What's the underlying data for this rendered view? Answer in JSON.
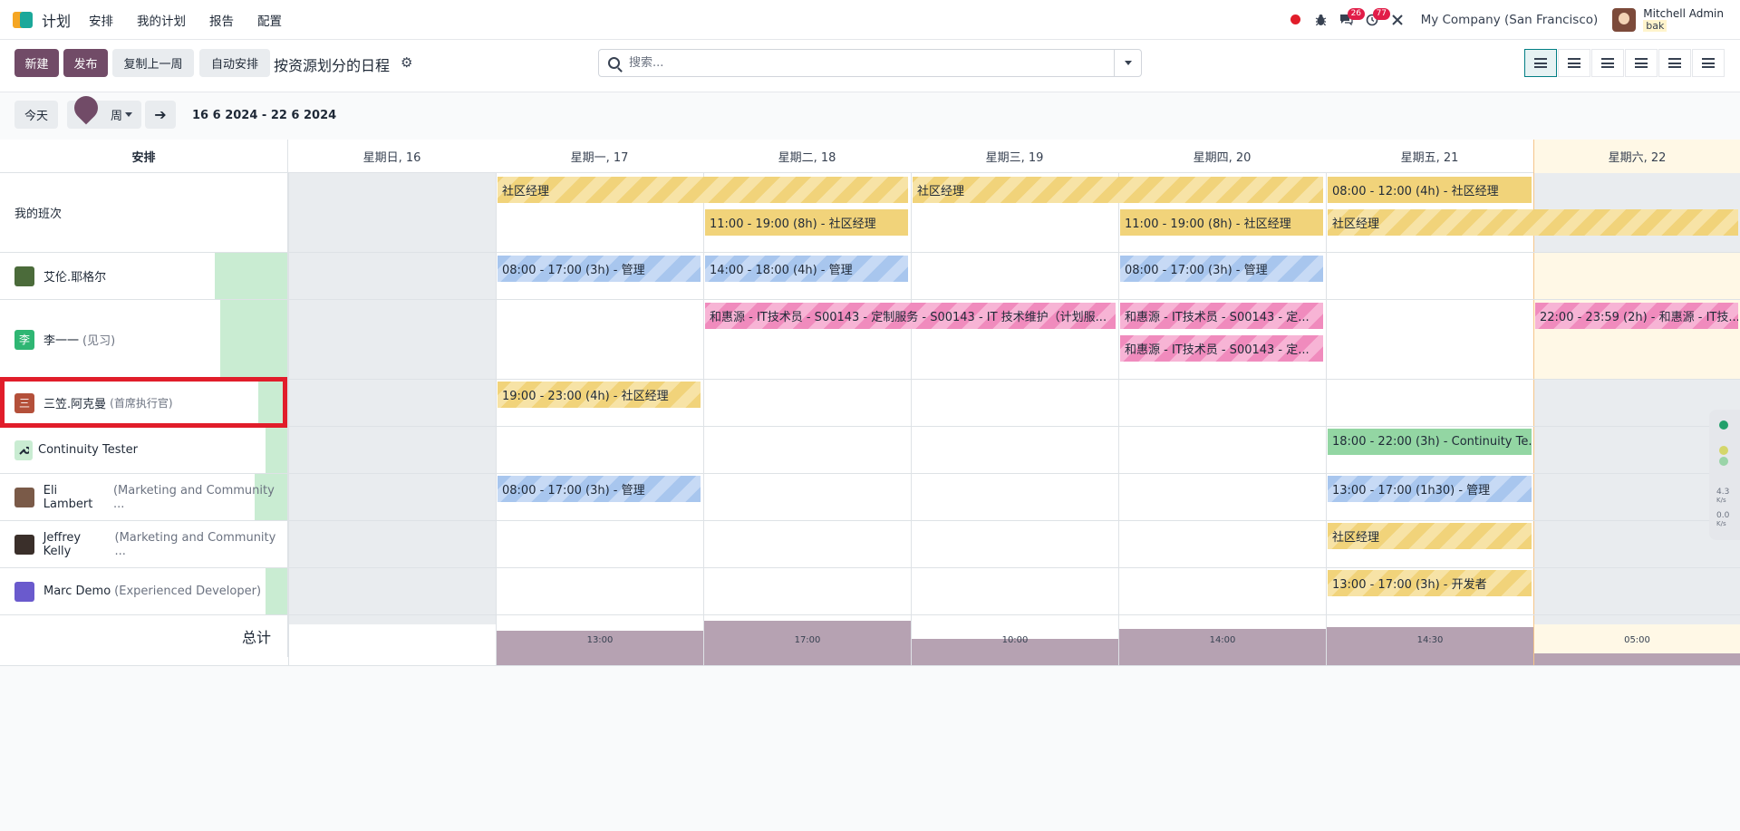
{
  "navbar": {
    "app_name": "计划",
    "menu": [
      "安排",
      "我的计划",
      "报告",
      "配置"
    ],
    "chat_badge": "26",
    "activity_badge": "77",
    "company": "My Company (San Francisco)",
    "user_name": "Mitchell Admin",
    "user_db": "bak"
  },
  "control": {
    "new_label": "新建",
    "publish_label": "发布",
    "copy_prev_label": "复制上一周",
    "auto_plan_label": "自动安排",
    "view_title": "按资源划分的日程",
    "search_placeholder": "搜索..."
  },
  "toolbar": {
    "today_label": "今天",
    "scale_label": "周",
    "range_label": "16 6 2024 - 22 6 2024"
  },
  "gantt": {
    "header_first": "安排",
    "days": [
      "星期日, 16",
      "星期一, 17",
      "星期二, 18",
      "星期三, 19",
      "星期四, 20",
      "星期五, 21",
      "星期六, 22"
    ],
    "rows": [
      {
        "name": "我的班次",
        "sub": ""
      },
      {
        "name": "艾伦.耶格尔",
        "sub": ""
      },
      {
        "name": "李一一",
        "sub": "(见习)",
        "initial": "李"
      },
      {
        "name": "三笠.阿克曼",
        "sub": "(首席执行官)",
        "initial": "三"
      },
      {
        "name": "Continuity Tester",
        "sub": ""
      },
      {
        "name": "Eli Lambert",
        "sub": "(Marketing and Community ..."
      },
      {
        "name": "Jeffrey Kelly",
        "sub": "(Marketing and Community ..."
      },
      {
        "name": "Marc Demo",
        "sub": "(Experienced Developer)"
      }
    ],
    "pills": {
      "s1": "社区经理",
      "s2": "社区经理",
      "s3": "08:00 - 12:00 (4h) - 社区经理",
      "s4": "11:00 - 19:00 (8h) - 社区经理",
      "s5": "11:00 - 19:00 (8h) - 社区经理",
      "s6": "社区经理",
      "a1": "08:00 - 17:00 (3h) - 管理",
      "a2": "14:00 - 18:00 (4h) - 管理",
      "a3": "08:00 - 17:00 (3h) - 管理",
      "l1": "和惠源 - IT技术员 - S00143 - 定制服务 - S00143 - IT 技术维护（计划服...",
      "l2": "和惠源 - IT技术员 - S00143 - 定...",
      "l3": "和惠源 - IT技术员 - S00143 - 定...",
      "l4": "22:00 - 23:59 (2h) - 和惠源 - IT技...",
      "m1": "19:00 - 23:00 (4h) - 社区经理",
      "c1": "18:00 - 22:00 (3h) - Continuity Te...",
      "e1": "08:00 - 17:00 (3h) - 管理",
      "e2": "13:00 - 17:00 (1h30) - 管理",
      "j1": "社区经理",
      "d1": "13:00 - 17:00 (3h) - 开发者"
    },
    "total_label": "总计",
    "totals": [
      "13:00",
      "17:00",
      "10:00",
      "14:00",
      "14:30",
      "05:00"
    ]
  },
  "side_widget": {
    "up": "4.3",
    "up_unit": "K/s",
    "down": "0.0",
    "down_unit": "K/s"
  },
  "colors": {
    "primary": "#714b67",
    "highlight": "#e11d2a"
  }
}
